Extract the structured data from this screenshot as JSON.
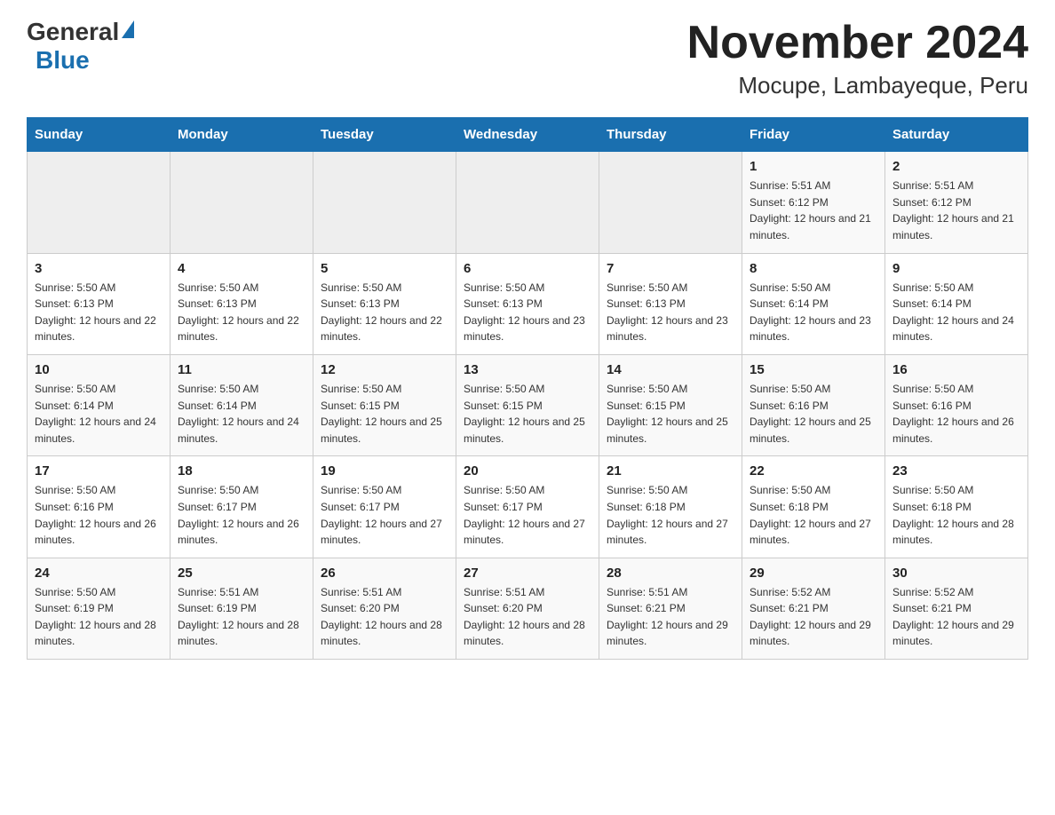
{
  "header": {
    "logo_general": "General",
    "logo_blue": "Blue",
    "title": "November 2024",
    "subtitle": "Mocupe, Lambayeque, Peru"
  },
  "calendar": {
    "days_of_week": [
      "Sunday",
      "Monday",
      "Tuesday",
      "Wednesday",
      "Thursday",
      "Friday",
      "Saturday"
    ],
    "rows": [
      {
        "cells": [
          {
            "day": "",
            "info": ""
          },
          {
            "day": "",
            "info": ""
          },
          {
            "day": "",
            "info": ""
          },
          {
            "day": "",
            "info": ""
          },
          {
            "day": "",
            "info": ""
          },
          {
            "day": "1",
            "info": "Sunrise: 5:51 AM\nSunset: 6:12 PM\nDaylight: 12 hours and 21 minutes."
          },
          {
            "day": "2",
            "info": "Sunrise: 5:51 AM\nSunset: 6:12 PM\nDaylight: 12 hours and 21 minutes."
          }
        ]
      },
      {
        "cells": [
          {
            "day": "3",
            "info": "Sunrise: 5:50 AM\nSunset: 6:13 PM\nDaylight: 12 hours and 22 minutes."
          },
          {
            "day": "4",
            "info": "Sunrise: 5:50 AM\nSunset: 6:13 PM\nDaylight: 12 hours and 22 minutes."
          },
          {
            "day": "5",
            "info": "Sunrise: 5:50 AM\nSunset: 6:13 PM\nDaylight: 12 hours and 22 minutes."
          },
          {
            "day": "6",
            "info": "Sunrise: 5:50 AM\nSunset: 6:13 PM\nDaylight: 12 hours and 23 minutes."
          },
          {
            "day": "7",
            "info": "Sunrise: 5:50 AM\nSunset: 6:13 PM\nDaylight: 12 hours and 23 minutes."
          },
          {
            "day": "8",
            "info": "Sunrise: 5:50 AM\nSunset: 6:14 PM\nDaylight: 12 hours and 23 minutes."
          },
          {
            "day": "9",
            "info": "Sunrise: 5:50 AM\nSunset: 6:14 PM\nDaylight: 12 hours and 24 minutes."
          }
        ]
      },
      {
        "cells": [
          {
            "day": "10",
            "info": "Sunrise: 5:50 AM\nSunset: 6:14 PM\nDaylight: 12 hours and 24 minutes."
          },
          {
            "day": "11",
            "info": "Sunrise: 5:50 AM\nSunset: 6:14 PM\nDaylight: 12 hours and 24 minutes."
          },
          {
            "day": "12",
            "info": "Sunrise: 5:50 AM\nSunset: 6:15 PM\nDaylight: 12 hours and 25 minutes."
          },
          {
            "day": "13",
            "info": "Sunrise: 5:50 AM\nSunset: 6:15 PM\nDaylight: 12 hours and 25 minutes."
          },
          {
            "day": "14",
            "info": "Sunrise: 5:50 AM\nSunset: 6:15 PM\nDaylight: 12 hours and 25 minutes."
          },
          {
            "day": "15",
            "info": "Sunrise: 5:50 AM\nSunset: 6:16 PM\nDaylight: 12 hours and 25 minutes."
          },
          {
            "day": "16",
            "info": "Sunrise: 5:50 AM\nSunset: 6:16 PM\nDaylight: 12 hours and 26 minutes."
          }
        ]
      },
      {
        "cells": [
          {
            "day": "17",
            "info": "Sunrise: 5:50 AM\nSunset: 6:16 PM\nDaylight: 12 hours and 26 minutes."
          },
          {
            "day": "18",
            "info": "Sunrise: 5:50 AM\nSunset: 6:17 PM\nDaylight: 12 hours and 26 minutes."
          },
          {
            "day": "19",
            "info": "Sunrise: 5:50 AM\nSunset: 6:17 PM\nDaylight: 12 hours and 27 minutes."
          },
          {
            "day": "20",
            "info": "Sunrise: 5:50 AM\nSunset: 6:17 PM\nDaylight: 12 hours and 27 minutes."
          },
          {
            "day": "21",
            "info": "Sunrise: 5:50 AM\nSunset: 6:18 PM\nDaylight: 12 hours and 27 minutes."
          },
          {
            "day": "22",
            "info": "Sunrise: 5:50 AM\nSunset: 6:18 PM\nDaylight: 12 hours and 27 minutes."
          },
          {
            "day": "23",
            "info": "Sunrise: 5:50 AM\nSunset: 6:18 PM\nDaylight: 12 hours and 28 minutes."
          }
        ]
      },
      {
        "cells": [
          {
            "day": "24",
            "info": "Sunrise: 5:50 AM\nSunset: 6:19 PM\nDaylight: 12 hours and 28 minutes."
          },
          {
            "day": "25",
            "info": "Sunrise: 5:51 AM\nSunset: 6:19 PM\nDaylight: 12 hours and 28 minutes."
          },
          {
            "day": "26",
            "info": "Sunrise: 5:51 AM\nSunset: 6:20 PM\nDaylight: 12 hours and 28 minutes."
          },
          {
            "day": "27",
            "info": "Sunrise: 5:51 AM\nSunset: 6:20 PM\nDaylight: 12 hours and 28 minutes."
          },
          {
            "day": "28",
            "info": "Sunrise: 5:51 AM\nSunset: 6:21 PM\nDaylight: 12 hours and 29 minutes."
          },
          {
            "day": "29",
            "info": "Sunrise: 5:52 AM\nSunset: 6:21 PM\nDaylight: 12 hours and 29 minutes."
          },
          {
            "day": "30",
            "info": "Sunrise: 5:52 AM\nSunset: 6:21 PM\nDaylight: 12 hours and 29 minutes."
          }
        ]
      }
    ]
  }
}
